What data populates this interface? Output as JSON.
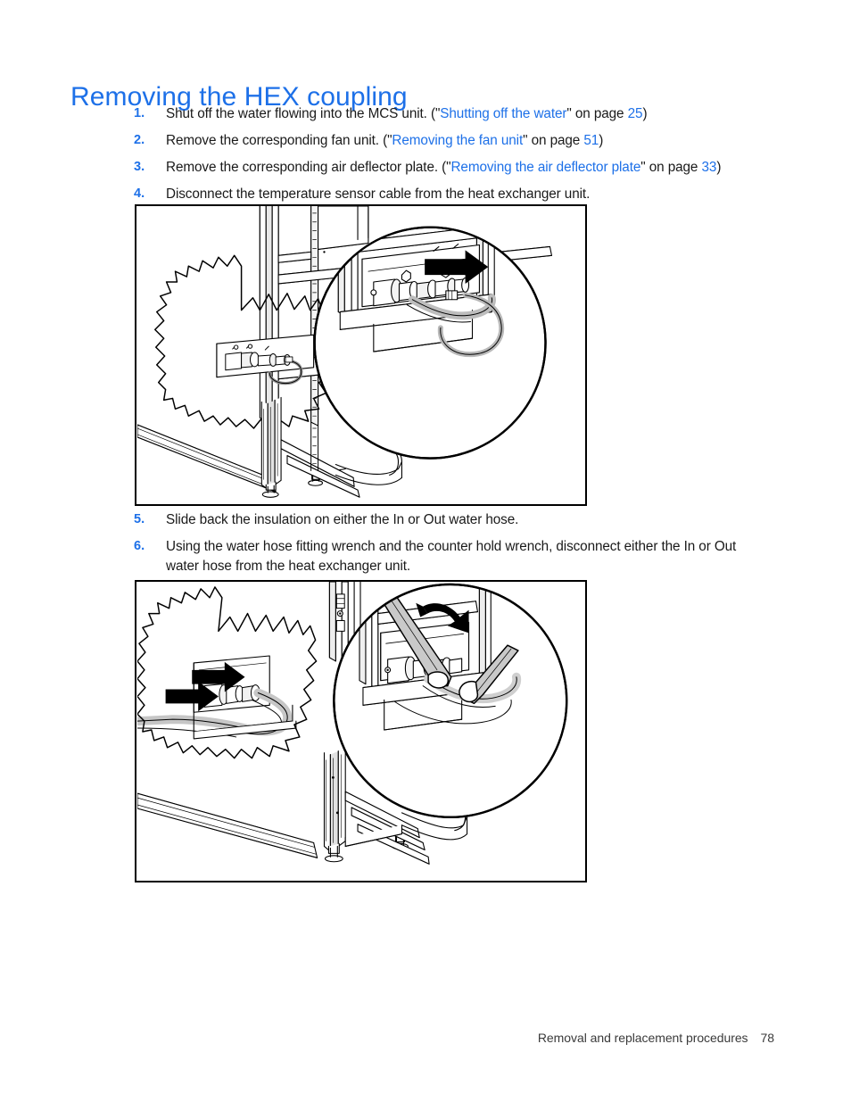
{
  "document": {
    "title": "Removing the HEX coupling",
    "title_color": "#1d70e8"
  },
  "procedure": {
    "steps_part1": [
      {
        "number": "1.",
        "text_before": "Shut off the water flowing into the MCS unit. (\"",
        "link": "Shutting off the water",
        "text_mid": "\" on page ",
        "page": "25",
        "text_after": ")"
      },
      {
        "number": "2.",
        "text_before": "Remove the corresponding fan unit. (\"",
        "link": "Removing the fan unit",
        "text_mid": "\" on page ",
        "page": "51",
        "text_after": ")"
      },
      {
        "number": "3.",
        "text_before": "Remove the corresponding air deflector plate. (\"",
        "link": "Removing the air deflector plate",
        "text_mid": "\" on page ",
        "page": "33",
        "text_after": ")"
      },
      {
        "number": "4.",
        "text_before": "Disconnect the temperature sensor cable from the heat exchanger unit.",
        "link": "",
        "text_mid": "",
        "page": "",
        "text_after": ""
      }
    ],
    "steps_part2": [
      {
        "number": "5.",
        "text_before": "Slide back the insulation on either the In or Out water hose.",
        "link": "",
        "text_mid": "",
        "page": "",
        "text_after": ""
      },
      {
        "number": "6.",
        "text_before": "Using the water hose fitting wrench and the counter hold wrench, disconnect either the In or Out water hose from the heat exchanger unit.",
        "link": "",
        "text_mid": "",
        "page": "",
        "text_after": ""
      }
    ]
  },
  "figures": [
    {
      "id": "figure-1",
      "caption_alt": "Line drawing of rack with detail callout circle showing temperature sensor cable being disconnected from heat exchanger unit, black arrow indicating pull direction"
    },
    {
      "id": "figure-2",
      "caption_alt": "Line drawing of rack with two black arrows showing insulation slid back, and detail callout circle showing water hose fitting wrench and counter hold wrench with counter-clockwise rotation arrow"
    }
  ],
  "footer": {
    "section": "Removal and replacement procedures",
    "page_number": "78"
  }
}
